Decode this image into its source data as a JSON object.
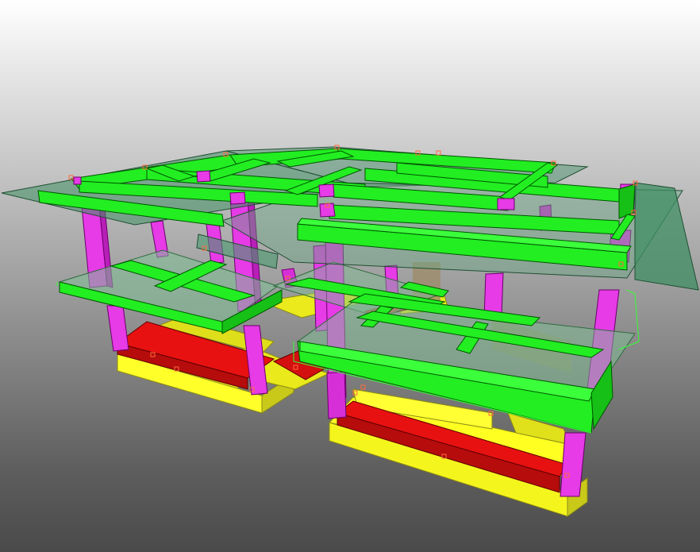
{
  "viewer": {
    "background": {
      "top": "#ffffff",
      "bottom": "#4a4a4a"
    }
  },
  "palette": {
    "beam": "#22ee22",
    "beam_side": "#12b812",
    "column": "#e63be6",
    "column_side": "#b81fb8",
    "footing": "#ffff22",
    "footing_side": "#c9c91a",
    "tie_beam": "#e81111",
    "tie_beam_side": "#9e0b0b",
    "slab": "#7fbf95",
    "roof": "#3f8f63",
    "wall": "#9d8c6a",
    "node": "#ff6a3c"
  },
  "model": {
    "element_types": [
      "roof-slab",
      "floor-slab",
      "beam",
      "column",
      "footing",
      "tie-beam",
      "node"
    ]
  }
}
